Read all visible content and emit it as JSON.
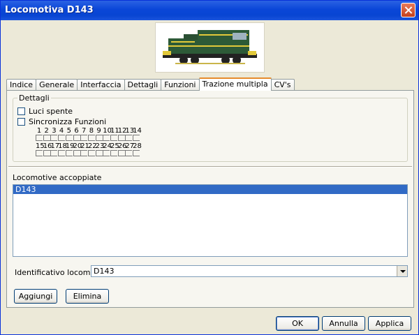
{
  "window": {
    "title": "Locomotiva D143"
  },
  "icons": {
    "close": "close-icon",
    "dropdown": "chevron-down-icon"
  },
  "tabs": [
    {
      "label": "Indice"
    },
    {
      "label": "Generale"
    },
    {
      "label": "Interfaccia"
    },
    {
      "label": "Dettagli"
    },
    {
      "label": "Funzioni"
    },
    {
      "label": "Trazione multipla"
    },
    {
      "label": "CV's"
    }
  ],
  "active_tab": "Trazione multipla",
  "details": {
    "title": "Dettagli",
    "lights_off": {
      "label": "Luci spente",
      "checked": false
    },
    "sync_functions": {
      "label": "Sincronizza Funzioni",
      "checked": false
    },
    "functions_row1": [
      "1",
      "2",
      "3",
      "4",
      "5",
      "6",
      "7",
      "8",
      "9",
      "10",
      "11",
      "12",
      "13",
      "14"
    ],
    "functions_row2": [
      "15",
      "16",
      "17",
      "18",
      "19",
      "20",
      "21",
      "22",
      "23",
      "24",
      "25",
      "26",
      "27",
      "28"
    ]
  },
  "coupled": {
    "label": "Locomotive accoppiate",
    "items": [
      "D143"
    ]
  },
  "locomotive_id": {
    "label": "Identificativo locomotiva",
    "value": "D143"
  },
  "buttons": {
    "add": "Aggiungi",
    "delete": "Elimina",
    "ok": "OK",
    "cancel": "Annulla",
    "apply": "Applica"
  },
  "colors": {
    "title_bar": "#0a46d8",
    "selection": "#316ac5",
    "active_tab_accent": "#e68b2c",
    "loco_body": "#2d5a37",
    "loco_stripe": "#e2c93a"
  }
}
